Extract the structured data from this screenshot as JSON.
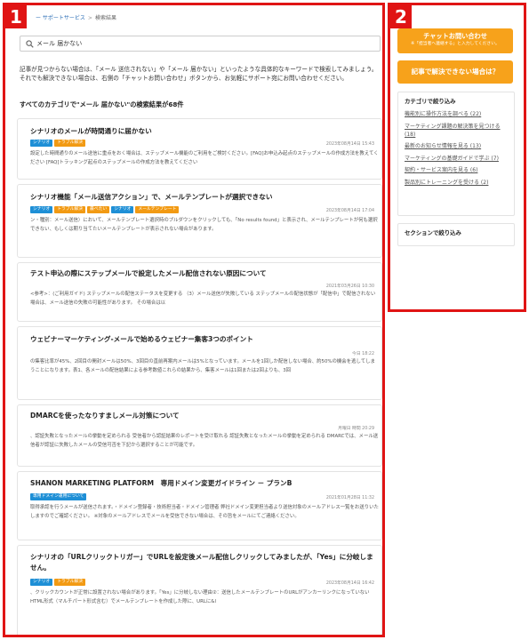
{
  "panels": {
    "main_number": "1",
    "side_number": "2"
  },
  "breadcrumb": {
    "parent": "ー サポートサービス",
    "separator": ">",
    "current": "検索結果"
  },
  "search": {
    "value": "メール 届かない",
    "icon": "search-icon"
  },
  "intro": "記事が見つからない場合は、「メール 送信されない」や「メール 届かない」といったような具体的なキーワードで検索してみましょう。それでも解決できない場合は、右側の「チャットお問い合わせ」ボタンから、お気軽にサポート宛にお問い合わせください。",
  "results_heading": "すべてのカテゴリで\"メール 届かない\"の検索結果が68件",
  "results": [
    {
      "title": "シナリオのメールが時間通りに届かない",
      "tags": [
        {
          "label": "シナリオ",
          "color": "blue"
        },
        {
          "label": "トラブル解決",
          "color": "orange"
        }
      ],
      "date": "2023年08月14日 15:43",
      "excerpt": "設定した時間通りのメール送信に重点をおく場合は、ステップメール機能のご利用をご検討ください。[FAQ]お申込み起点のステップメールの作成方法を教えてください [FAQ]トラッキング起点のステップメールの作成方法を教えてください"
    },
    {
      "title": "シナリオ機能「メール送信アクション」で、メールテンプレートが選択できない",
      "tags": [
        {
          "label": "シナリオ",
          "color": "blue"
        },
        {
          "label": "トラブル解決",
          "color": "orange"
        },
        {
          "label": "最べたい",
          "color": "orange"
        },
        {
          "label": "シナリオ",
          "color": "blue"
        },
        {
          "label": "メールテンプレート",
          "color": "orange"
        }
      ],
      "date": "2023年08月14日 17:04",
      "excerpt": "ン・種別：メール送信）において、メールテンプレート選択時のプルダウンをクリックしても、「No results found」と表示され、メールテンプレートが何も選択できない、もしくは期り当てたいメールテンプレートが表示されない場合があります。"
    },
    {
      "title": "テスト申込の際にステップメールで設定したメール配信されない原因について",
      "tags": [],
      "date": "2021年03月26日 10:30",
      "excerpt": "<参考>：(ご利用ガイド) ステップメールの配信ステータスを変更する （3）メール送信が失敗している ステップメールの配信状態が「配信中」で配信されない場合は、メール送信の失敗の可能性があります。 その場合は以"
    },
    {
      "title": "ウェビナーマーケティング-メールで始めるウェビナー集客3つのポイント",
      "tags": [],
      "date": "今日 18:22",
      "excerpt": "の集客比率が45%、2回目の開封メールは50%、3回目の直前再案内メールは5%となっています。メールを1回しか配信しない場合、約50%の機会を逃してしまうことになります。表1、各メールの配信結果による参考数値これらの結果から、集客メールは1回または2回よりも、3回"
    },
    {
      "title": "DMARCを使ったなりすましメール対策について",
      "tags": [],
      "date": "月曜日 時間 20:29",
      "excerpt": "、認証失敗となったメールの挙動を定められる 受信者から認証結果のレポートを受け取れる 認証失敗となったメールの挙動を定められる DMARCでは、メール送信者が認証に失敗したメールの受信可否を下記から選択することが可能です。"
    },
    {
      "title": "SHANON MARKETING PLATFORM　専用ドメイン変更ガイドライン － プランB",
      "tags": [
        {
          "label": "専用ドメイン運用について",
          "color": "blue"
        }
      ],
      "date": "2021年01月28日 11:32",
      "excerpt": "取得承認を行うメールが送信されます。・ドメイン登録者・技術担当者・ドメイン管理者 弊社ドメイン変更担当者より送信対象のメールアドレス一覧をお送りいたしますのでご確認ください。 ※対象のメールアドレスでメールを受信できない場合は、その旨をメールにてご連絡ください。"
    },
    {
      "title": "シナリオの「URLクリックトリガー」でURLを設定後メール配信しクリックしてみましたが、「Yes」に分岐しません。",
      "tags": [
        {
          "label": "シナリオ",
          "color": "blue"
        },
        {
          "label": "トラブル解決",
          "color": "orange"
        }
      ],
      "date": "2023年08月14日 16:42",
      "excerpt": "、クリックカウントが正常に設置されない場合があります。「Yes」に分岐しない理由②：送信したメールテンプレートのURLがアンカーリンクになっていないHTML形式（マルチパート形式含む）でメールテンプレートを作成した際に、URLに&l"
    }
  ],
  "sidebar": {
    "chat_button": {
      "label": "チャットお問い合わせ",
      "note": "※「担当者へ連絡する」と入力してください。"
    },
    "faq_button": {
      "label": "記事で解決できない場合は？"
    },
    "category_filter": {
      "title": "カテゴリで絞り込み",
      "items": [
        "機能別に操作方法を調べる (22)",
        "マーケティング課題の解決策を見つける (18)",
        "最新のお知らせ情報を見る (13)",
        "マーケティングの基礎ガイドで学ぶ (7)",
        "契約・サービス案内を見る (6)",
        "製品別にトレーニングを受ける (2)"
      ]
    },
    "section_filter": {
      "title": "セクションで絞り込み"
    }
  },
  "colors": {
    "accent": "#f7a21b",
    "frame": "#e01414",
    "tag_blue": "#1e8fd6",
    "tag_orange": "#f29a13"
  }
}
